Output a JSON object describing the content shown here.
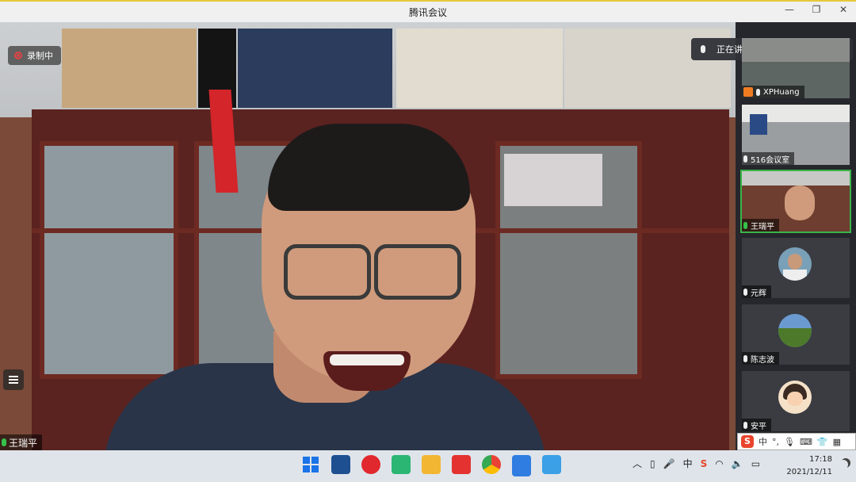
{
  "window": {
    "title": "腾讯会议"
  },
  "recording": {
    "label": "录制中"
  },
  "active_speaker": {
    "name": "王瑞平"
  },
  "talking_banner": {
    "label": "正在讲话: 王瑞平;"
  },
  "participants": [
    {
      "name": "XPHuang"
    },
    {
      "name": "516会议室"
    },
    {
      "name": "王瑞平"
    },
    {
      "name": "元辉"
    },
    {
      "name": "陈志波"
    },
    {
      "name": "安平"
    }
  ],
  "ime": {
    "brand": "S",
    "mode": "中",
    "punct": "°,"
  },
  "tray": {
    "ime_indicator": "中"
  },
  "clock": {
    "time": "17:18",
    "date": "2021/12/11"
  }
}
